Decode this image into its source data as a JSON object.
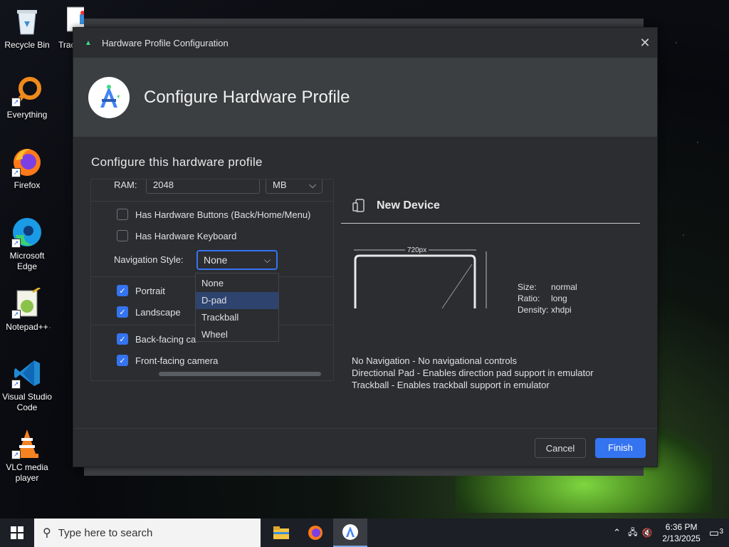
{
  "desktop": {
    "icons": [
      {
        "label": "Recycle Bin"
      },
      {
        "label": "Everything"
      },
      {
        "label": "Firefox"
      },
      {
        "label": "Microsoft Edge"
      },
      {
        "label": "Notepad++"
      },
      {
        "label": "Visual Studio Code"
      },
      {
        "label": "VLC media player"
      },
      {
        "label": "Trac"
      }
    ]
  },
  "dialog": {
    "window_title": "Hardware Profile Configuration",
    "banner_title": "Configure Hardware Profile",
    "section_title": "Configure this hardware profile",
    "ram_label": "RAM:",
    "ram_value": "2048",
    "ram_unit": "MB",
    "has_hardware_buttons": {
      "label": "Has Hardware Buttons (Back/Home/Menu)",
      "checked": false
    },
    "has_hardware_keyboard": {
      "label": "Has Hardware Keyboard",
      "checked": false
    },
    "navigation_style_label": "Navigation Style:",
    "navigation_style_value": "None",
    "navigation_options": [
      "None",
      "D-pad",
      "Trackball",
      "Wheel"
    ],
    "highlighted_option": "D-pad",
    "portrait": {
      "label": "Portrait",
      "checked": true
    },
    "landscape": {
      "label": "Landscape",
      "checked": true
    },
    "back_camera": {
      "label": "Back-facing ca",
      "checked": true
    },
    "front_camera": {
      "label": "Front-facing camera",
      "checked": true
    },
    "device_name": "New Device",
    "preview_width_label": "720px",
    "spec_labels": {
      "size": "Size:",
      "ratio": "Ratio:",
      "density": "Density:"
    },
    "spec_values": {
      "size": "normal",
      "ratio": "long",
      "density": "xhdpi"
    },
    "descriptions": [
      "No Navigation - No navigational controls",
      "Directional Pad - Enables direction pad support in emulator",
      "Trackball - Enables trackball support in emulator"
    ],
    "cancel_label": "Cancel",
    "finish_label": "Finish"
  },
  "taskbar": {
    "search_placeholder": "Type here to search",
    "time": "6:36 PM",
    "date": "2/13/2025",
    "notification_count": "3"
  },
  "colors": {
    "accent": "#3574f0",
    "dialog_bg": "#2b2d30",
    "banner_bg": "#3c3f41"
  }
}
